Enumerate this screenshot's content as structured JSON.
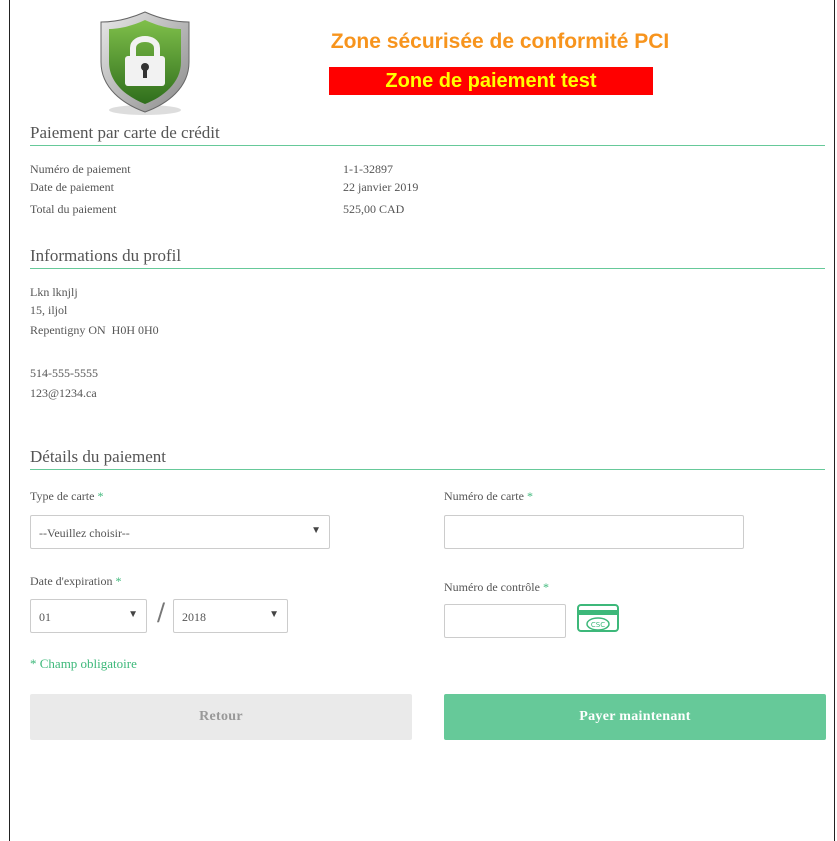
{
  "header": {
    "title": "Zone sécurisée de conformité PCI",
    "test_banner": "Zone de paiement test",
    "colors": {
      "title": "#f7941d",
      "banner_bg": "#ff0000",
      "banner_text": "#ffff00",
      "accent": "#66c999"
    }
  },
  "payment_section": {
    "title": "Paiement par carte de crédit",
    "rows": [
      {
        "label": "Numéro de paiement",
        "value": "1-1-32897"
      },
      {
        "label": "Date de paiement",
        "value": "22 janvier 2019"
      },
      {
        "label": "Total du paiement",
        "value": "525,00 CAD"
      }
    ]
  },
  "profile_section": {
    "title": "Informations du profil",
    "name": "Lkn lknjlj",
    "address1": "15, iljol",
    "city_line": "Repentigny ON  H0H 0H0",
    "phone": "514-555-5555",
    "email": "123@1234.ca"
  },
  "details_section": {
    "title": "Détails du paiement",
    "card_type": {
      "label": "Type de carte",
      "required_mark": "*",
      "selected": "--Veuillez choisir--"
    },
    "card_number": {
      "label": "Numéro de carte",
      "required_mark": "*",
      "value": ""
    },
    "expiration": {
      "label": "Date d'expiration",
      "required_mark": "*",
      "month": "01",
      "year": "2018",
      "separator": "/"
    },
    "cvv": {
      "label": "Numéro de contrôle",
      "required_mark": "*",
      "value": "",
      "icon_text": "CSC"
    },
    "mandatory_note": "* Champ obligatoire"
  },
  "buttons": {
    "back": "Retour",
    "pay": "Payer maintenant"
  }
}
